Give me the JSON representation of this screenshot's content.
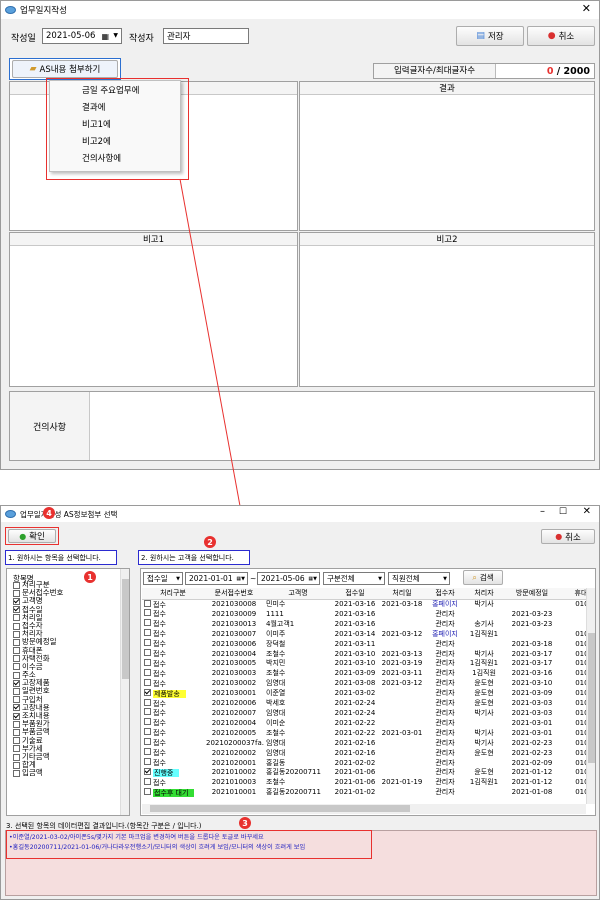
{
  "main_window": {
    "title": "업무일지작성",
    "date_label": "작성일",
    "date_value": "2021-05-06",
    "author_label": "작성자",
    "author_value": "관리자",
    "save_label": "저장",
    "cancel_label": "취소",
    "attach_label": "AS내용 첨부하기",
    "char_count_label": "입력글자수/최대글자수",
    "char_count_current": "0",
    "char_count_sep": "/",
    "char_count_max": "2000",
    "menu_items": [
      "금일 주요업무에",
      "결과에",
      "비고1에",
      "비고2에",
      "건의사항에"
    ],
    "result_header": "결과",
    "note1_header": "비고1",
    "note2_header": "비고2",
    "suggestion_label": "건의사항"
  },
  "dialog": {
    "title": "업무일지작성 AS정보첨부 선택",
    "confirm_label": "확인",
    "cancel_label": "취소",
    "section1_label": "1. 원하시는 항목을 선택합니다.",
    "section2_label": "2. 원하시는 고객을 선택합니다.",
    "section3_label": "3. 선택된 항목의 데이터편집 결과입니다.(항목간 구분은 / 입니다.)",
    "items_header": "항목명",
    "items": [
      {
        "label": "처리구분",
        "checked": false
      },
      {
        "label": "문서접수번호",
        "checked": false
      },
      {
        "label": "고객명",
        "checked": true
      },
      {
        "label": "접수일",
        "checked": true
      },
      {
        "label": "처리일",
        "checked": false
      },
      {
        "label": "접수자",
        "checked": false
      },
      {
        "label": "처리자",
        "checked": false
      },
      {
        "label": "방문예정일",
        "checked": false
      },
      {
        "label": "휴대폰",
        "checked": false
      },
      {
        "label": "자택전화",
        "checked": false
      },
      {
        "label": "이수금",
        "checked": false
      },
      {
        "label": "주소",
        "checked": false
      },
      {
        "label": "고장제품",
        "checked": true
      },
      {
        "label": "일련번호",
        "checked": false
      },
      {
        "label": "구입처",
        "checked": false
      },
      {
        "label": "고장내용",
        "checked": true
      },
      {
        "label": "조치내용",
        "checked": true
      },
      {
        "label": "부품원가",
        "checked": false
      },
      {
        "label": "부품금액",
        "checked": false
      },
      {
        "label": "기술료",
        "checked": false
      },
      {
        "label": "부가세",
        "checked": false
      },
      {
        "label": "기타금액",
        "checked": false
      },
      {
        "label": "합계",
        "checked": false
      },
      {
        "label": "입금액",
        "checked": false
      }
    ],
    "filter_field": "접수일",
    "filter_from": "2021-01-01",
    "filter_tilde": "~",
    "filter_to": "2021-05-06",
    "filter_type": "구분전체",
    "filter_staff": "직원전체",
    "search_label": "검색",
    "columns": [
      "처리구분",
      "문서접수번호",
      "고객명",
      "접수일",
      "처리일",
      "접수자",
      "처리자",
      "방문예정일",
      "휴대"
    ],
    "rows": [
      {
        "checked": false,
        "type": "접수",
        "hl": "",
        "no": "2021030008",
        "name": "민미수",
        "recv": "2021-03-16",
        "done": "2021-03-18",
        "rby": "홍페이지",
        "rblue": true,
        "by": "박기사",
        "visit": "",
        "phone": "010-29"
      },
      {
        "checked": false,
        "type": "접수",
        "hl": "",
        "no": "2021030009",
        "name": "1111",
        "recv": "2021-03-16",
        "done": "",
        "rby": "관리자",
        "rblue": false,
        "by": "",
        "visit": "2021-03-23",
        "phone": ""
      },
      {
        "checked": false,
        "type": "접수",
        "hl": "",
        "no": "2021030013",
        "name": "4월고객1",
        "recv": "2021-03-16",
        "done": "",
        "rby": "관리자",
        "rblue": false,
        "by": "송기사",
        "visit": "2021-03-23",
        "phone": ""
      },
      {
        "checked": false,
        "type": "접수",
        "hl": "",
        "no": "2021030007",
        "name": "이미주",
        "recv": "2021-03-14",
        "done": "2021-03-12",
        "rby": "홍페이지",
        "rblue": true,
        "by": "1김직원1",
        "visit": "",
        "phone": "010-29"
      },
      {
        "checked": false,
        "type": "접수",
        "hl": "",
        "no": "2021030006",
        "name": "장덕철",
        "recv": "2021-03-11",
        "done": "",
        "rby": "관리자",
        "rblue": false,
        "by": "",
        "visit": "2021-03-18",
        "phone": "010-29"
      },
      {
        "checked": false,
        "type": "접수",
        "hl": "",
        "no": "2021030004",
        "name": "조철수",
        "recv": "2021-03-10",
        "done": "2021-03-13",
        "rby": "관리자",
        "rblue": false,
        "by": "박기사",
        "visit": "2021-03-17",
        "phone": "010-29"
      },
      {
        "checked": false,
        "type": "접수",
        "hl": "",
        "no": "2021030005",
        "name": "박지민",
        "recv": "2021-03-10",
        "done": "2021-03-19",
        "rby": "관리자",
        "rblue": false,
        "by": "1김직원1",
        "visit": "2021-03-17",
        "phone": "010-29"
      },
      {
        "checked": false,
        "type": "접수",
        "hl": "",
        "no": "2021030003",
        "name": "조철수",
        "recv": "2021-03-09",
        "done": "2021-03-11",
        "rby": "관리자",
        "rblue": false,
        "by": "1김직원",
        "visit": "2021-03-16",
        "phone": "010-29"
      },
      {
        "checked": false,
        "type": "접수",
        "hl": "",
        "no": "2021030002",
        "name": "임영대",
        "recv": "2021-03-08",
        "done": "2021-03-12",
        "rby": "관리자",
        "rblue": false,
        "by": "윤도현",
        "visit": "2021-03-10",
        "phone": "010-29"
      },
      {
        "checked": true,
        "type": "제품발송",
        "hl": "y",
        "no": "2021030001",
        "name": "이준열",
        "recv": "2021-03-02",
        "done": "",
        "rby": "관리자",
        "rblue": false,
        "by": "윤도현",
        "visit": "2021-03-09",
        "phone": "010-57"
      },
      {
        "checked": false,
        "type": "접수",
        "hl": "",
        "no": "2021020006",
        "name": "박세호",
        "recv": "2021-02-24",
        "done": "",
        "rby": "관리자",
        "rblue": false,
        "by": "윤도현",
        "visit": "2021-03-03",
        "phone": "010-29"
      },
      {
        "checked": false,
        "type": "접수",
        "hl": "",
        "no": "2021020007",
        "name": "임영대",
        "recv": "2021-02-24",
        "done": "",
        "rby": "관리자",
        "rblue": false,
        "by": "박기사",
        "visit": "2021-03-03",
        "phone": "010-56"
      },
      {
        "checked": false,
        "type": "접수",
        "hl": "",
        "no": "2021020004",
        "name": "이미순",
        "recv": "2021-02-22",
        "done": "",
        "rby": "관리자",
        "rblue": false,
        "by": "",
        "visit": "2021-03-01",
        "phone": "010-12"
      },
      {
        "checked": false,
        "type": "접수",
        "hl": "",
        "no": "2021020005",
        "name": "조철수",
        "recv": "2021-02-22",
        "done": "2021-03-01",
        "rby": "관리자",
        "rblue": false,
        "by": "박기사",
        "visit": "2021-03-01",
        "phone": "010-29"
      },
      {
        "checked": false,
        "type": "접수",
        "hl": "",
        "no": "20210200037fa...",
        "name": "임영대",
        "recv": "2021-02-16",
        "done": "",
        "rby": "관리자",
        "rblue": false,
        "by": "박기사",
        "visit": "2021-02-23",
        "phone": "010-29"
      },
      {
        "checked": false,
        "type": "접수",
        "hl": "",
        "no": "2021020002",
        "name": "임영대",
        "recv": "2021-02-16",
        "done": "",
        "rby": "관리자",
        "rblue": false,
        "by": "윤도현",
        "visit": "2021-02-23",
        "phone": "010-56"
      },
      {
        "checked": false,
        "type": "접수",
        "hl": "",
        "no": "2021020001",
        "name": "홍길동",
        "recv": "2021-02-02",
        "done": "",
        "rby": "관리자",
        "rblue": false,
        "by": "",
        "visit": "2021-02-09",
        "phone": "010-29"
      },
      {
        "checked": true,
        "type": "진행중",
        "hl": "c",
        "no": "2021010002",
        "name": "홍길동20200711",
        "recv": "2021-01-06",
        "done": "",
        "rby": "관리자",
        "rblue": false,
        "by": "윤도현",
        "visit": "2021-01-12",
        "phone": "010-29"
      },
      {
        "checked": false,
        "type": "접수",
        "hl": "",
        "no": "2021010003",
        "name": "조철수",
        "recv": "2021-01-06",
        "done": "2021-01-19",
        "rby": "관리자",
        "rblue": false,
        "by": "1김직원1",
        "visit": "2021-01-12",
        "phone": "010-29"
      },
      {
        "checked": false,
        "type": "접수후 대기",
        "hl": "g",
        "no": "2021010001",
        "name": "홍길동20200711",
        "recv": "2021-01-02",
        "done": "",
        "rby": "관리자",
        "rblue": false,
        "by": "",
        "visit": "2021-01-08",
        "phone": "010-29"
      }
    ],
    "result_lines": [
      "•이준열/2021-03-02/아이폰5s/몇가지 기본 마크업을 변경하여 버튼을 드롭다운 토글로 바꾸세요",
      "•홍길동20200711/2021-01-06/거나다라우전행소기/모니터의 색상이 흐려게 보임/모니터의 색상이 흐려게 보임"
    ],
    "badges": [
      "1",
      "2",
      "3",
      "4"
    ]
  }
}
